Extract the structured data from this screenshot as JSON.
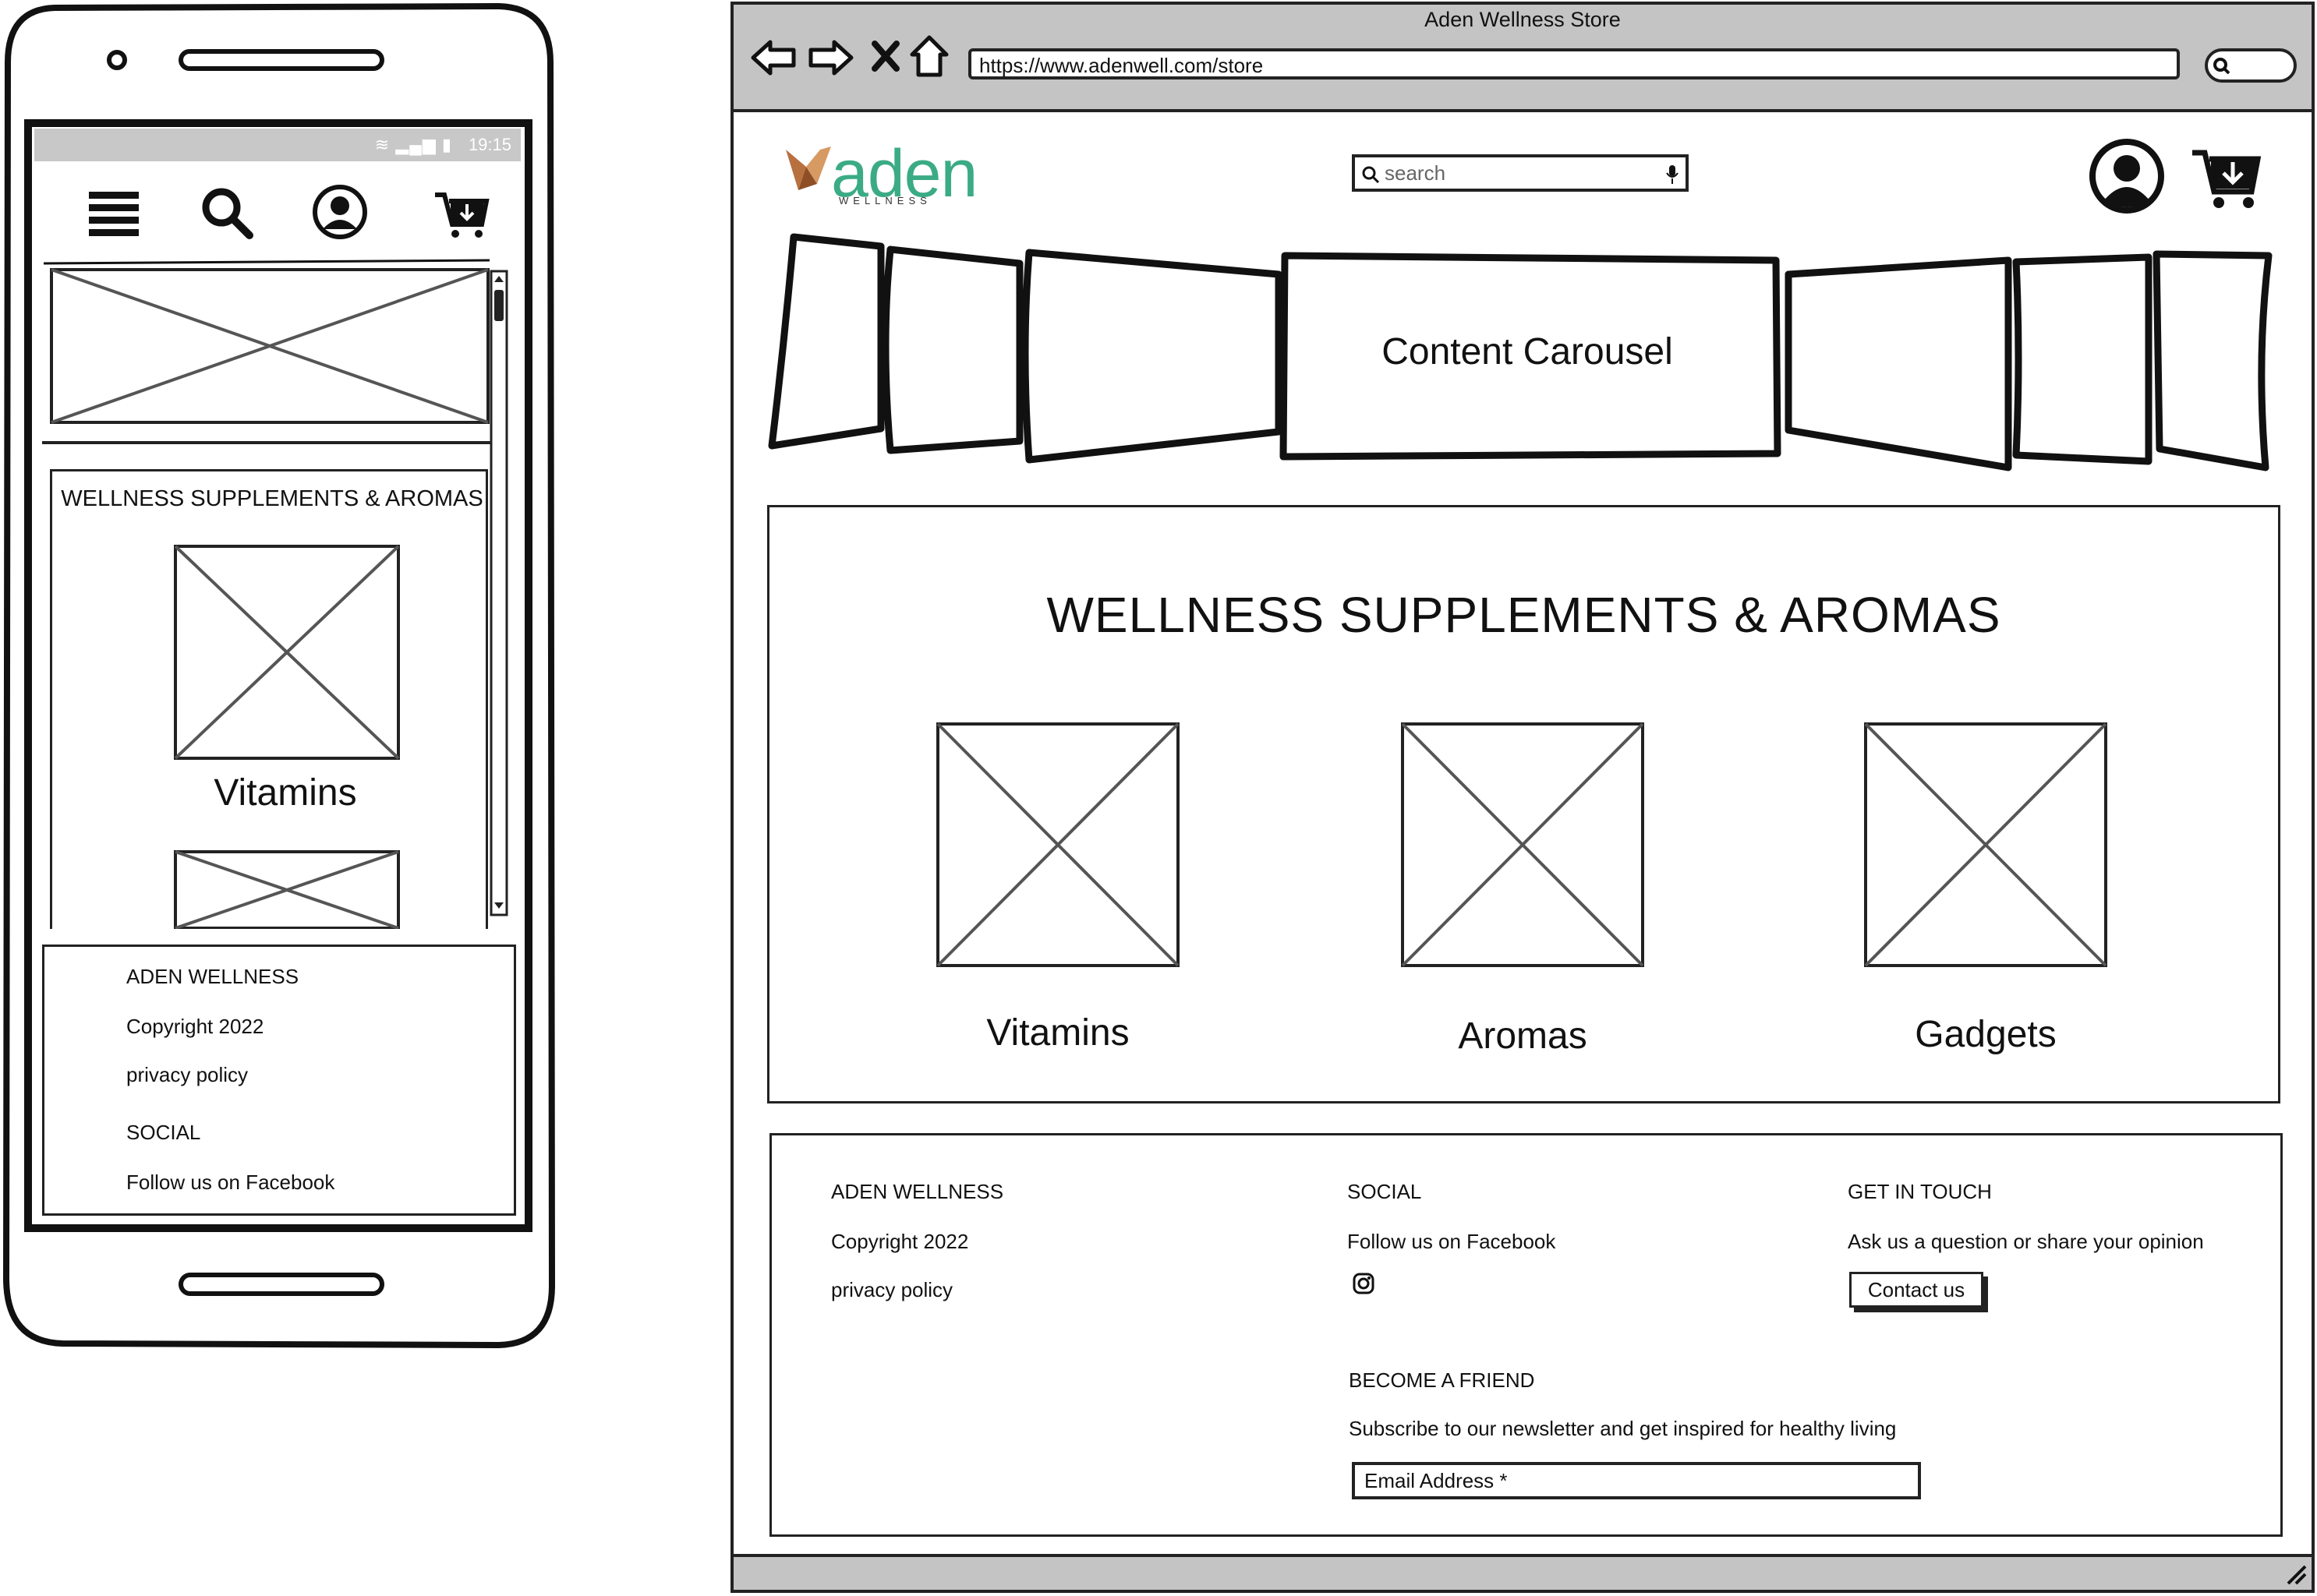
{
  "mobile": {
    "status_bar": {
      "time": "19:15"
    },
    "nav_icons": [
      "menu-icon",
      "search-icon",
      "user-icon",
      "cart-icon"
    ],
    "section_title": "WELLNESS SUPPLEMENTS & AROMAS",
    "category_label": "Vitamins",
    "footer": {
      "brand": "ADEN WELLNESS",
      "copyright": "Copyright 2022",
      "privacy": "privacy policy",
      "social_heading": "SOCIAL",
      "facebook": "Follow us on Facebook"
    }
  },
  "browser": {
    "window_title": "Aden Wellness Store",
    "url": "https://www.adenwell.com/store",
    "nav_controls": [
      "back-icon",
      "forward-icon",
      "close-icon",
      "home-icon"
    ]
  },
  "header": {
    "logo_text": "aden",
    "logo_subtext": "WELLNESS",
    "search_placeholder": "search"
  },
  "carousel": {
    "label": "Content Carousel"
  },
  "main": {
    "section_title": "WELLNESS SUPPLEMENTS & AROMAS",
    "categories": [
      {
        "label": "Vitamins"
      },
      {
        "label": "Aromas"
      },
      {
        "label": "Gadgets"
      }
    ]
  },
  "footer": {
    "brand": "ADEN WELLNESS",
    "copyright": "Copyright 2022",
    "privacy": "privacy policy",
    "social_heading": "SOCIAL",
    "facebook": "Follow us on Facebook",
    "contact_heading": "GET IN TOUCH",
    "contact_text": "Ask us a question or share your opinion",
    "contact_button": "Contact us",
    "friend_heading": "BECOME A FRIEND",
    "newsletter_text": "Subscribe to our newsletter and get inspired for healthy living",
    "email_placeholder": "Email Address *"
  },
  "colors": {
    "logo_green": "#3bab85",
    "logo_copper": "#b9703f",
    "chrome_gray": "#c4c4c4"
  }
}
